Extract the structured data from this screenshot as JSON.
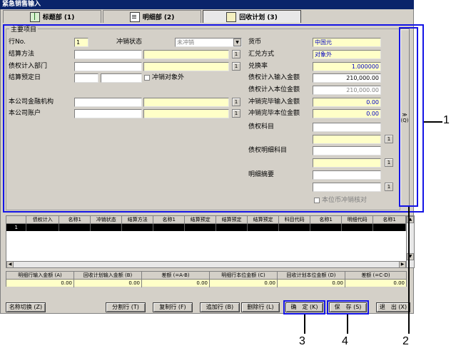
{
  "window": {
    "title": "紧急销售输入"
  },
  "tabs": [
    {
      "label": "标题部 (1)",
      "icon": "book-icon"
    },
    {
      "label": "明细部 (2)",
      "icon": "document-icon"
    },
    {
      "label": "回收计划 (3)",
      "icon": "calculator-icon"
    }
  ],
  "group": {
    "title": "主要项目"
  },
  "left_form": {
    "row_no_label": "行No.",
    "row_no_value": "1",
    "offset_status_label": "冲销状态",
    "offset_status_value": "未冲销",
    "settle_method_label": "结算方法",
    "claim_dept_label": "债权计入部门",
    "settle_date_label": "结算预定日",
    "exclude_label": "冲销对象外",
    "bank_label": "本公司金融机构",
    "account_label": "本公司账户",
    "btn_one": "1"
  },
  "right_form": {
    "currency_label": "货币",
    "currency_value": "中国元",
    "rate_method_label": "汇兑方式",
    "rate_method_value": "对象外",
    "rate_label": "兑换率",
    "rate_value": "1.000000",
    "claim_input_amt_label": "债权计入输入金额",
    "claim_input_amt_value": "210,000.00",
    "claim_local_amt_label": "债权计入本位金额",
    "claim_local_amt_value": "210,000.00",
    "offset_input_amt_label": "冲销完毕输入金额",
    "offset_input_amt_value": "0.00",
    "offset_local_amt_label": "冲销完毕本位金额",
    "offset_local_amt_value": "0.00",
    "claim_subject_label": "债权科目",
    "claim_detail_label": "债权明细科目",
    "detail_summary_label": "明细摘要",
    "local_offset_label": "本位币冲销核对"
  },
  "side_button": {
    "label": "≫",
    "sub": "(Q)"
  },
  "grid": {
    "columns": [
      "",
      "债权计入",
      "名称1",
      "冲销状态",
      "结算方法",
      "名称1",
      "结算预定",
      "结算预定",
      "结算预定",
      "科目代码",
      "名称1",
      "明细代码",
      "名称1"
    ],
    "rows": [
      [
        "1",
        "",
        "",
        "",
        "",
        "",
        "",
        "",
        "",
        "",
        "",
        "",
        ""
      ]
    ]
  },
  "totals": [
    {
      "label": "明细行输入金额 (A)",
      "value": "0.00"
    },
    {
      "label": "回收计划输入金额 (B)",
      "value": "0.00"
    },
    {
      "label": "差额 (=A-B)",
      "value": "0.00"
    },
    {
      "label": "明细行本位金额 (C)",
      "value": "0.00"
    },
    {
      "label": "回收计划本位金额 (D)",
      "value": "0.00"
    },
    {
      "label": "差额 (=C-D)",
      "value": "0.00"
    }
  ],
  "buttons": {
    "name_switch": "名称切换 (Z)",
    "split_row": "分割行 (T)",
    "copy_row": "复制行 (F)",
    "add_row": "追加行 (B)",
    "delete_row": "删除行 (L)",
    "ok": "确　定 (K)",
    "save": "保　存 (S)",
    "exit": "退　出 (X)"
  },
  "callouts": {
    "c1": "1",
    "c2": "2",
    "c3": "3",
    "c4": "4"
  },
  "colors": {
    "highlight": "#1414e6",
    "input_yellow": "#ffffc8",
    "title_blue": "#0a246a"
  }
}
